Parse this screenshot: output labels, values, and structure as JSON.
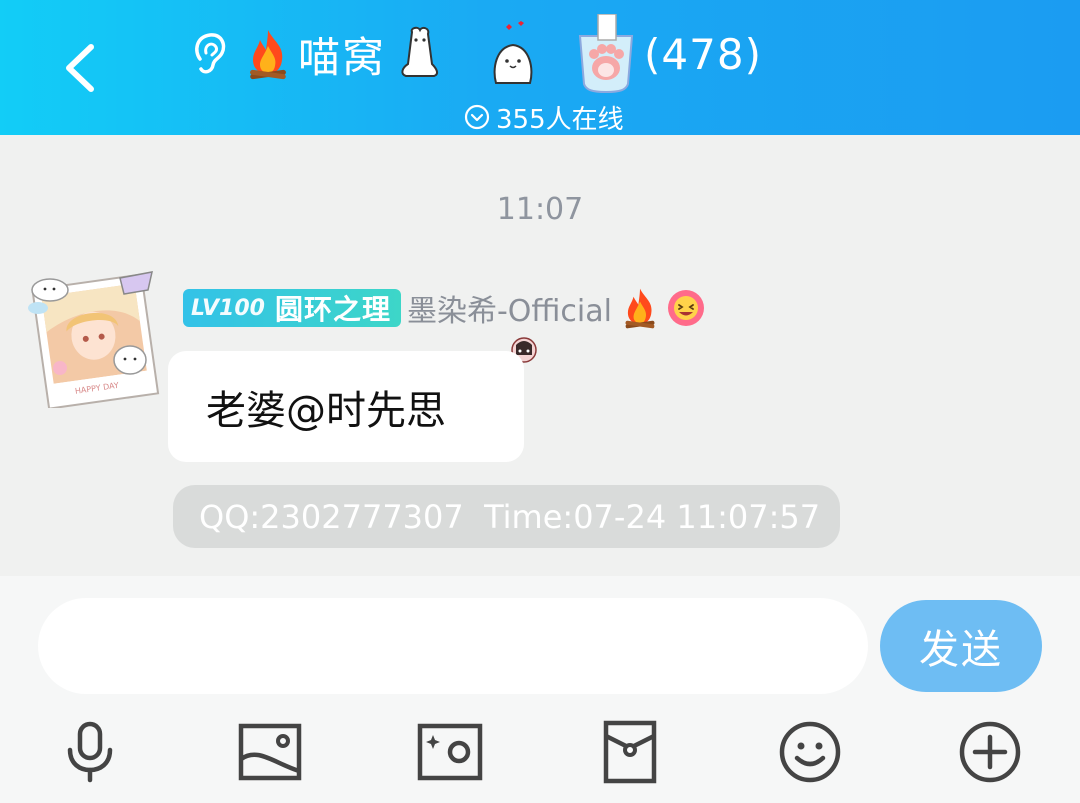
{
  "header": {
    "group_name": "喵窝",
    "member_count": "(478)",
    "online_text": "355人在线",
    "icons": [
      "back-arrow-icon",
      "ear-icon",
      "fire-icon",
      "ghost-sticker",
      "heart-ghost-sticker",
      "cat-paw-cup-sticker",
      "chevron-down-circle-icon"
    ]
  },
  "chat": {
    "time_divider": "11:07",
    "message": {
      "level": "LV100",
      "title": "圆环之理",
      "sender": "墨染希-Official",
      "text": "老婆@时先思",
      "info": "QQ:2302777307  Time:07-24 11:07:57"
    }
  },
  "input": {
    "value": "",
    "placeholder": "",
    "send_label": "发送"
  },
  "toolbar": {
    "items": [
      "microphone-icon",
      "image-icon",
      "camera-icon",
      "red-packet-icon",
      "emoji-icon",
      "add-icon"
    ]
  },
  "colors": {
    "header_start": "#12cdf7",
    "header_end": "#1b9cf2",
    "send_button": "#6ebdf3",
    "background": "#f0f1f0"
  }
}
